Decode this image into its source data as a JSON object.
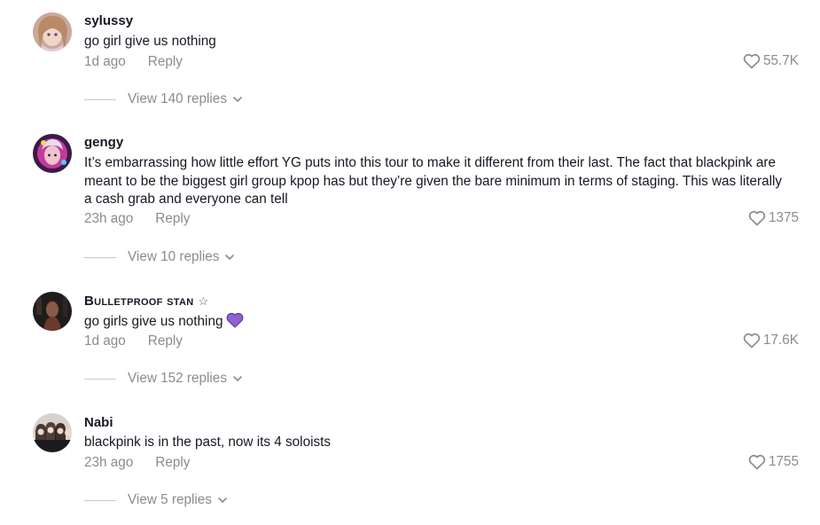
{
  "comments": [
    {
      "username": "sylussy",
      "text": "go girl give us nothing",
      "time": "1d ago",
      "reply": "Reply",
      "likes": "55.7K",
      "view_replies": "View 140 replies"
    },
    {
      "username": "gengy",
      "text": "It’s embarrassing how little effort YG puts into this tour to make it different from their last. The fact that blackpink are meant to be the biggest girl group kpop has but they’re given the bare minimum in terms of staging. This was literally a cash grab and everyone can tell",
      "time": "23h ago",
      "reply": "Reply",
      "likes": "1375",
      "view_replies": "View 10 replies"
    },
    {
      "username": "Bulletproof stan",
      "username_suffix": "☆",
      "text": "go girls give us nothing",
      "emoji": "purple-heart-emoji",
      "time": "1d ago",
      "reply": "Reply",
      "likes": "17.6K",
      "view_replies": "View 152 replies"
    },
    {
      "username": "Nabi",
      "text": "blackpink is in the past, now its 4 soloists",
      "time": "23h ago",
      "reply": "Reply",
      "likes": "1755",
      "view_replies": "View 5 replies"
    }
  ],
  "icons": {
    "like": "heart-outline-icon",
    "expand": "chevron-down-icon"
  },
  "colors": {
    "text": "#161823",
    "secondary": "#8a8b91",
    "emoji": "#8e62d6"
  }
}
